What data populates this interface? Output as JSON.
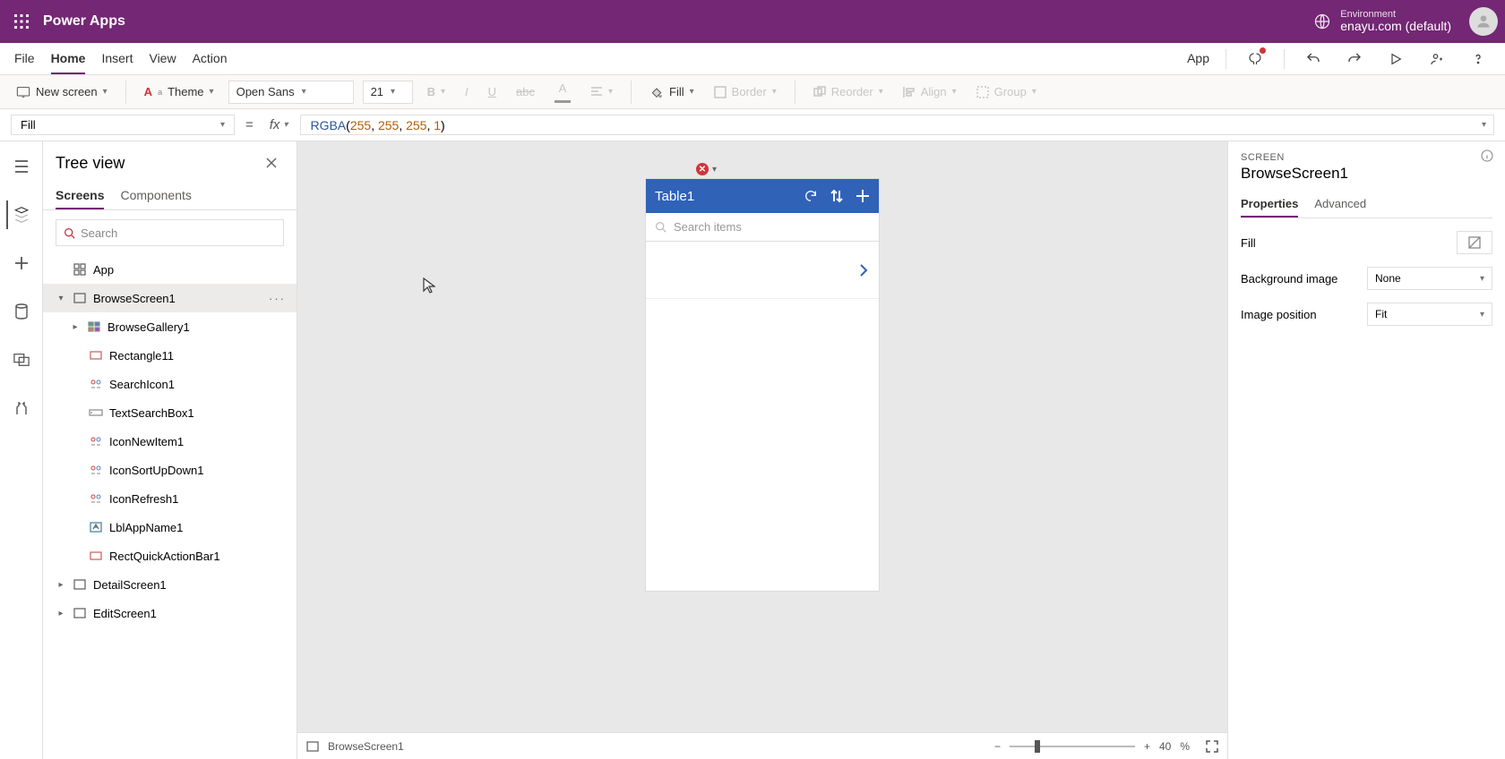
{
  "brand": "Power Apps",
  "environment": {
    "label": "Environment",
    "name": "enayu.com (default)"
  },
  "menu": {
    "items": [
      "File",
      "Home",
      "Insert",
      "View",
      "Action"
    ],
    "active": "Home",
    "app_label": "App"
  },
  "ribbon": {
    "new_screen": "New screen",
    "theme": "Theme",
    "font_family": "Open Sans",
    "font_size": "21",
    "fill": "Fill",
    "border": "Border",
    "reorder": "Reorder",
    "align": "Align",
    "group": "Group"
  },
  "formula_bar": {
    "property": "Fill",
    "formula_fn": "RGBA",
    "formula_args": [
      "255",
      "255",
      "255",
      "1"
    ]
  },
  "tree": {
    "title": "Tree view",
    "tabs": [
      "Screens",
      "Components"
    ],
    "active_tab": "Screens",
    "search_placeholder": "Search",
    "nodes": {
      "app": "App",
      "browse_screen": "BrowseScreen1",
      "browse_gallery": "BrowseGallery1",
      "rectangle11": "Rectangle11",
      "search_icon": "SearchIcon1",
      "text_search_box": "TextSearchBox1",
      "icon_new_item": "IconNewItem1",
      "icon_sort": "IconSortUpDown1",
      "icon_refresh": "IconRefresh1",
      "lbl_app_name": "LblAppName1",
      "rect_quick": "RectQuickActionBar1",
      "detail_screen": "DetailScreen1",
      "edit_screen": "EditScreen1"
    }
  },
  "phone": {
    "title": "Table1",
    "search_placeholder": "Search items"
  },
  "properties": {
    "section": "SCREEN",
    "name": "BrowseScreen1",
    "tabs": [
      "Properties",
      "Advanced"
    ],
    "active_tab": "Properties",
    "rows": {
      "fill": "Fill",
      "bg_image": "Background image",
      "bg_image_value": "None",
      "img_pos": "Image position",
      "img_pos_value": "Fit"
    }
  },
  "status": {
    "screen": "BrowseScreen1",
    "zoom": "40",
    "pct": "%"
  }
}
